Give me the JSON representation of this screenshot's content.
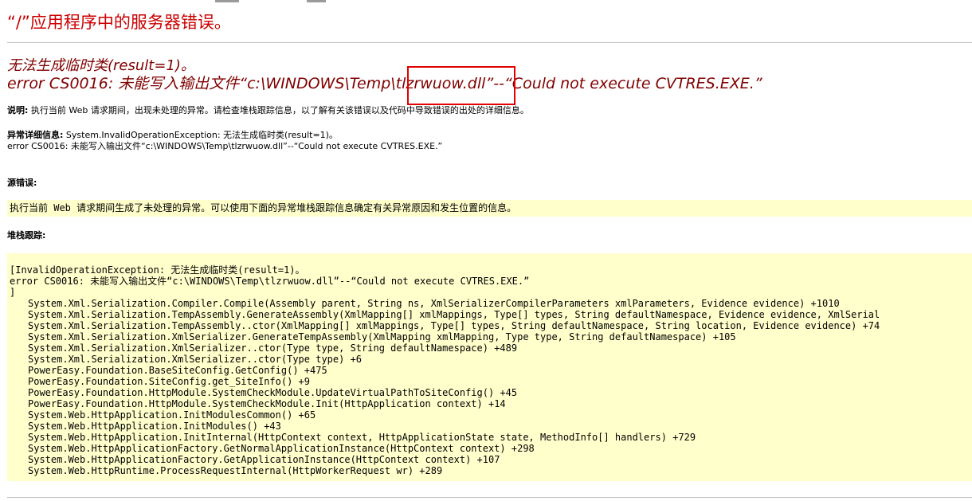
{
  "page": {
    "title": "“/”应用程序中的服务器错误。",
    "error_title_line1": "无法生成临时类(result=1)。",
    "error_title_line2": "error CS0016: 未能写入输出文件“c:\\WINDOWS\\Temp\\tlzrwuow.dll”--“Could not execute CVTRES.EXE.”"
  },
  "description": {
    "label": "说明:",
    "text": " 执行当前 Web 请求期间，出现未处理的异常。请检查堆栈跟踪信息，以了解有关该错误以及代码中导致错误的出处的详细信息。"
  },
  "exception_details": {
    "label": "异常详细信息:",
    "text": " System.InvalidOperationException: 无法生成临时类(result=1)。",
    "line2": "error CS0016: 未能写入输出文件“c:\\WINDOWS\\Temp\\tlzrwuow.dll”--“Could not execute CVTRES.EXE.”"
  },
  "source_error": {
    "label": "源错误:",
    "text": "执行当前 Web 请求期间生成了未处理的异常。可以使用下面的异常堆栈跟踪信息确定有关异常原因和发生位置的信息。"
  },
  "stack_trace": {
    "label": "堆栈跟踪:",
    "header_lines": [
      "[InvalidOperationException: 无法生成临时类(result=1)。",
      "error CS0016: 未能写入输出文件“c:\\WINDOWS\\Temp\\tlzrwuow.dll”--“Could not execute CVTRES.EXE.”",
      "]"
    ],
    "frames": [
      "System.Xml.Serialization.Compiler.Compile(Assembly parent, String ns, XmlSerializerCompilerParameters xmlParameters, Evidence evidence) +1010",
      "System.Xml.Serialization.TempAssembly.GenerateAssembly(XmlMapping[] xmlMappings, Type[] types, String defaultNamespace, Evidence evidence, XmlSerial",
      "System.Xml.Serialization.TempAssembly..ctor(XmlMapping[] xmlMappings, Type[] types, String defaultNamespace, String location, Evidence evidence) +74",
      "System.Xml.Serialization.XmlSerializer.GenerateTempAssembly(XmlMapping xmlMapping, Type type, String defaultNamespace) +105",
      "System.Xml.Serialization.XmlSerializer..ctor(Type type, String defaultNamespace) +489",
      "System.Xml.Serialization.XmlSerializer..ctor(Type type) +6",
      "PowerEasy.Foundation.BaseSiteConfig.GetConfig() +475",
      "PowerEasy.Foundation.SiteConfig.get_SiteInfo() +9",
      "PowerEasy.Foundation.HttpModule.SystemCheckModule.UpdateVirtualPathToSiteConfig() +45",
      "PowerEasy.Foundation.HttpModule.SystemCheckModule.Init(HttpApplication context) +14",
      "System.Web.HttpApplication.InitModulesCommon() +65",
      "System.Web.HttpApplication.InitModules() +43",
      "System.Web.HttpApplication.InitInternal(HttpContext context, HttpApplicationState state, MethodInfo[] handlers) +729",
      "System.Web.HttpApplicationFactory.GetNormalApplicationInstance(HttpContext context) +298",
      "System.Web.HttpApplicationFactory.GetApplicationInstance(HttpContext context) +107",
      "System.Web.HttpRuntime.ProcessRequestInternal(HttpWorkerRequest wr) +289"
    ]
  },
  "colors": {
    "title": "#cc0000",
    "error_heading": "#800000",
    "code_background": "#ffffcc",
    "annotation_box": "#e30000"
  }
}
